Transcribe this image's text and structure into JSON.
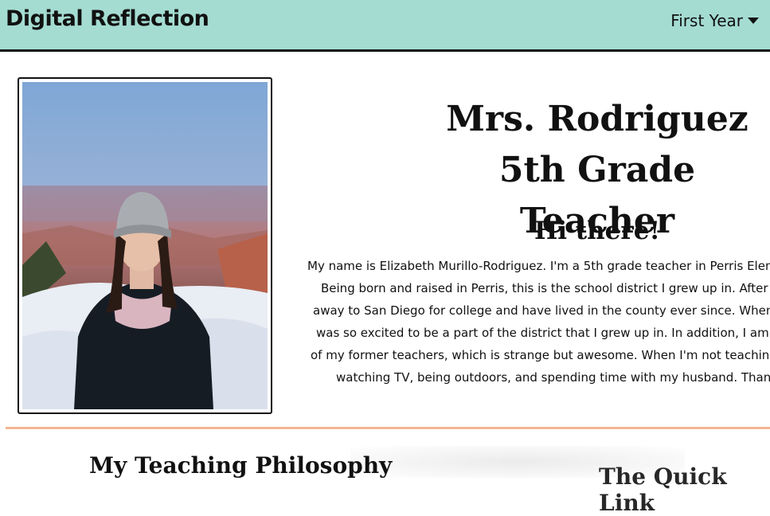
{
  "navbar": {
    "brand": "Digital Reflection",
    "dropdown_label": "First Year"
  },
  "profile": {
    "name": "Mrs. Rodriguez",
    "role": "5th Grade Teacher",
    "greeting": "Hi there!",
    "bio_lines": [
      "My name is Elizabeth Murillo-Rodriguez. I'm a 5th grade teacher in Perris Eleme",
      "Being born and raised in Perris, this is the school district I grew up in. After hig",
      "away to San Diego for college and have lived in the county ever since. When I c",
      "was so excited to be a part of the district that I grew up in. In addition, I am co",
      "of my former teachers, which is strange but awesome. When I'm not teaching I",
      "watching TV, being outdoors, and spending time with my husband. Thank you"
    ]
  },
  "sections": {
    "philosophy_title": "My Teaching Philosophy",
    "second_title": "The Quick Link"
  },
  "colors": {
    "navbar_bg": "#a4dcd2",
    "divider": "#f4b691"
  }
}
